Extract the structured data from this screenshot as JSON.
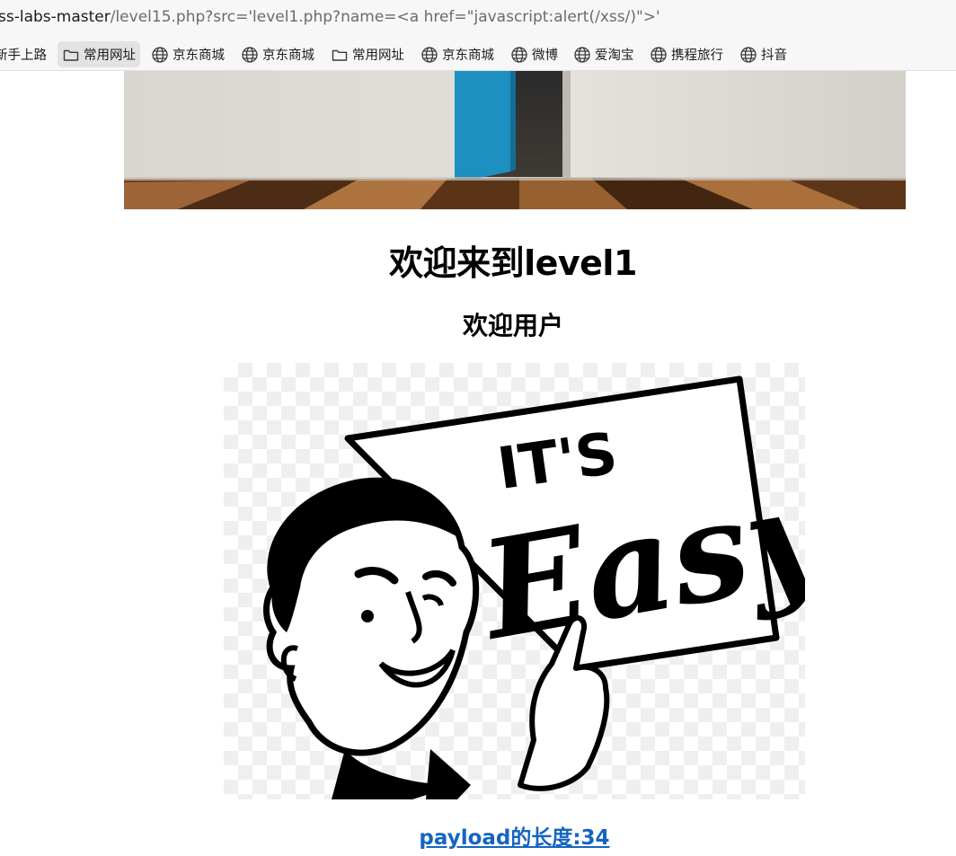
{
  "address_bar": {
    "host": "ss-labs-master",
    "path": "/level15.php?src='level1.php?name=<a href=\"javascript:alert(/xss/)\">'"
  },
  "bookmarks": [
    {
      "label": "新手上路",
      "icon": "none"
    },
    {
      "label": "常用网址",
      "icon": "folder-icon",
      "active": true
    },
    {
      "label": "京东商城",
      "icon": "globe-icon"
    },
    {
      "label": "京东商城",
      "icon": "globe-icon"
    },
    {
      "label": "常用网址",
      "icon": "folder-icon"
    },
    {
      "label": "京东商城",
      "icon": "globe-icon"
    },
    {
      "label": "微博",
      "icon": "globe-icon"
    },
    {
      "label": "爱淘宝",
      "icon": "globe-icon"
    },
    {
      "label": "携程旅行",
      "icon": "globe-icon"
    },
    {
      "label": "抖音",
      "icon": "globe-icon"
    }
  ],
  "page": {
    "heading": "欢迎来到level1",
    "subheading": "欢迎用户",
    "image_text": {
      "line1": "IT'S",
      "line2": "Easy"
    },
    "payload_link": "payload的长度:34"
  },
  "colors": {
    "link": "#1565c0",
    "door": "#1d8fc0"
  }
}
